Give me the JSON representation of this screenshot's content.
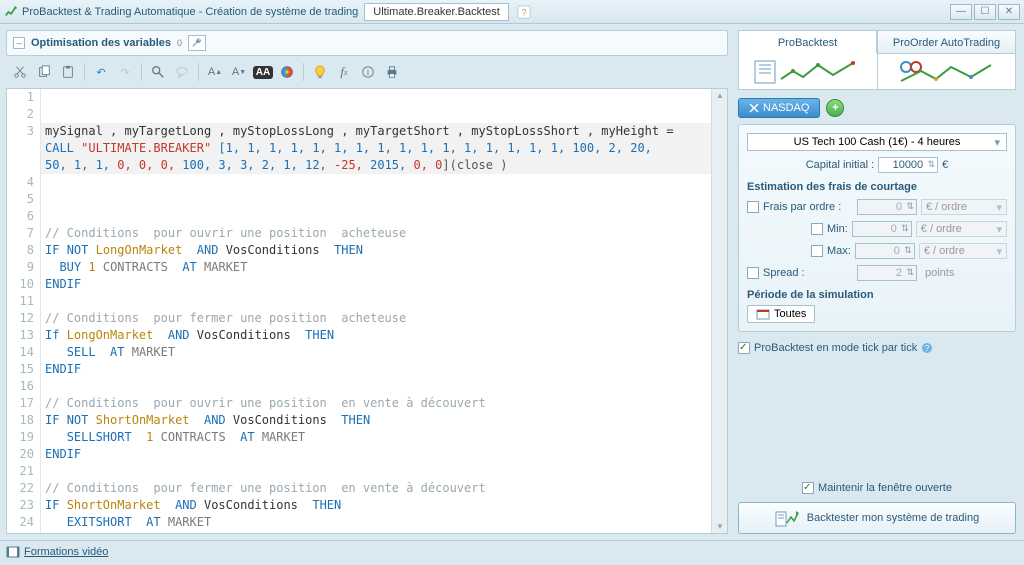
{
  "titlebar": {
    "app_title": "ProBacktest & Trading Automatique - Création de système de trading",
    "tab_title": "Ultimate.Breaker.Backtest"
  },
  "opt_header": {
    "title": "Optimisation des variables",
    "count": "0"
  },
  "code": {
    "line3": "mySignal , myTargetLong , myStopLossLong , myTargetShort , myStopLossShort , myHeight =",
    "call_kw": "CALL",
    "call_str": "\"ULTIMATE.BREAKER\"",
    "params_a": "[1, 1, 1, 1, 1, 1, 1, 1, 1, 1, 1, 1, 1, 1, 1, 1, 100, 2, 20,",
    "params_b1": "50, 1, 1, ",
    "params_zeros": "0, 0, 0, ",
    "params_b2": "100, 3, 3, 2, 1, 12, ",
    "params_neg": "-25, ",
    "params_b3": "2015, ",
    "params_zeros2": "0, 0",
    "params_close": "](close )",
    "cmt_open_long": "// Conditions  pour ouvrir une position  acheteuse",
    "cmt_close_long": "// Conditions  pour fermer une position  acheteuse",
    "cmt_open_short": "// Conditions  pour ouvrir une position  en vente à découvert",
    "cmt_close_short": "// Conditions  pour fermer une position  en vente à découvert",
    "kw_if": "IF",
    "kw_if_lc": "If",
    "kw_not": "NOT",
    "kw_and": "AND",
    "kw_then": "THEN",
    "kw_endif": "ENDIF",
    "var_longonmarket": "LongOnMarket",
    "var_shortonmarket": "ShortOnMarket",
    "var_vosconditions": "VosConditions",
    "kw_buy": "BUY",
    "kw_sell": "SELL",
    "kw_sellshort": "SELLSHORT",
    "kw_exitshort": "EXITSHORT",
    "num_1": "1",
    "kw_contracts": "CONTRACTS",
    "kw_at": "AT",
    "kw_market": "MARKET"
  },
  "right": {
    "tab_backtest": "ProBacktest",
    "tab_autotrade": "ProOrder AutoTrading",
    "nasdaq": "NASDAQ",
    "instrument": "US Tech 100 Cash (1€) - 4 heures",
    "capital_label": "Capital initial :",
    "capital_value": "10000",
    "currency": "€",
    "fees_head": "Estimation des frais de courtage",
    "fees_per_order": "Frais par ordre :",
    "fees_min": "Min:",
    "fees_max": "Max:",
    "spread": "Spread :",
    "zero": "0",
    "two": "2",
    "unit_order": "€ / ordre",
    "unit_points": "points",
    "period_head": "Période de la simulation",
    "period_all": "Toutes",
    "tick_mode": "ProBacktest en mode tick par tick",
    "keep_open": "Maintenir la fenêtre ouverte",
    "run_btn": "Backtester mon système de trading"
  },
  "footer": {
    "video_link": "Formations vidéo"
  }
}
